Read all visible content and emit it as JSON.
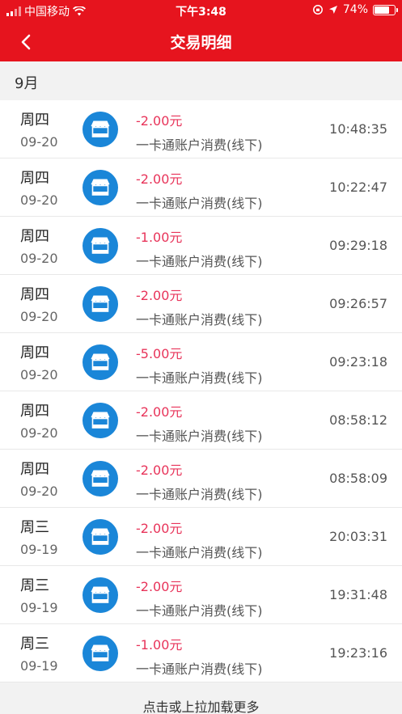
{
  "status_bar": {
    "carrier": "中国移动",
    "time": "下午3:48",
    "battery": "74%",
    "battery_level": 0.74
  },
  "nav": {
    "title": "交易明细"
  },
  "section": {
    "month": "9月"
  },
  "transactions": [
    {
      "weekday": "周四",
      "date": "09-20",
      "amount": "-2.00元",
      "desc": "一卡通账户消费(线下)",
      "time": "10:48:35"
    },
    {
      "weekday": "周四",
      "date": "09-20",
      "amount": "-2.00元",
      "desc": "一卡通账户消费(线下)",
      "time": "10:22:47"
    },
    {
      "weekday": "周四",
      "date": "09-20",
      "amount": "-1.00元",
      "desc": "一卡通账户消费(线下)",
      "time": "09:29:18"
    },
    {
      "weekday": "周四",
      "date": "09-20",
      "amount": "-2.00元",
      "desc": "一卡通账户消费(线下)",
      "time": "09:26:57"
    },
    {
      "weekday": "周四",
      "date": "09-20",
      "amount": "-5.00元",
      "desc": "一卡通账户消费(线下)",
      "time": "09:23:18"
    },
    {
      "weekday": "周四",
      "date": "09-20",
      "amount": "-2.00元",
      "desc": "一卡通账户消费(线下)",
      "time": "08:58:12"
    },
    {
      "weekday": "周四",
      "date": "09-20",
      "amount": "-2.00元",
      "desc": "一卡通账户消费(线下)",
      "time": "08:58:09"
    },
    {
      "weekday": "周三",
      "date": "09-19",
      "amount": "-2.00元",
      "desc": "一卡通账户消费(线下)",
      "time": "20:03:31"
    },
    {
      "weekday": "周三",
      "date": "09-19",
      "amount": "-2.00元",
      "desc": "一卡通账户消费(线下)",
      "time": "19:31:48"
    },
    {
      "weekday": "周三",
      "date": "09-19",
      "amount": "-1.00元",
      "desc": "一卡通账户消费(线下)",
      "time": "19:23:16"
    }
  ],
  "load_more": "点击或上拉加载更多",
  "colors": {
    "brand_red": "#e6141e",
    "amount_red": "#e8345a",
    "icon_blue": "#1a86d8"
  },
  "icons": {
    "back": "chevron-left-icon",
    "merchant": "store-icon"
  }
}
